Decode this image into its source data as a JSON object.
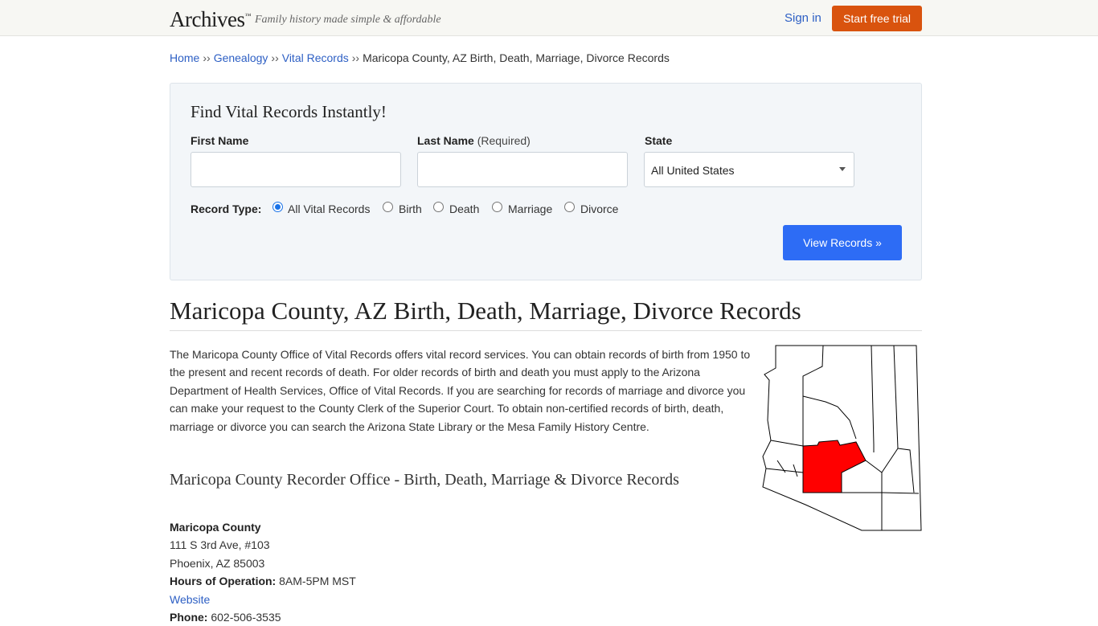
{
  "header": {
    "logo": "Archives",
    "logo_mark": "™",
    "tagline": "Family history made simple & affordable",
    "signin": "Sign in",
    "trial": "Start free trial"
  },
  "breadcrumb": {
    "items": [
      "Home",
      "Genealogy",
      "Vital Records"
    ],
    "separator": "››",
    "current": "Maricopa County, AZ Birth, Death, Marriage, Divorce Records"
  },
  "search": {
    "title": "Find Vital Records Instantly!",
    "first_name_label": "First Name",
    "last_name_label": "Last Name",
    "last_name_req": "(Required)",
    "state_label": "State",
    "state_value": "All United States",
    "record_type_label": "Record Type:",
    "record_types": [
      "All Vital Records",
      "Birth",
      "Death",
      "Marriage",
      "Divorce"
    ],
    "selected_record_type": "All Vital Records",
    "submit": "View Records »"
  },
  "main": {
    "title": "Maricopa County, AZ Birth, Death, Marriage, Divorce Records",
    "intro": "The Maricopa County Office of Vital Records offers vital record services. You can obtain records of birth from 1950 to the present and recent records of death. For older records of birth and death you must apply to the Arizona Department of Health Services, Office of Vital Records. If you are searching for records of marriage and divorce you can make your request to the County Clerk of the Superior Court. To obtain non-certified records of birth, death, marriage or divorce you can search the Arizona State Library or the Mesa Family History Centre.",
    "section_title": "Maricopa County Recorder Office - Birth, Death, Marriage & Divorce Records"
  },
  "office": {
    "name": "Maricopa County",
    "street": "111 S 3rd Ave, #103",
    "city": "Phoenix, AZ 85003",
    "hours_label": "Hours of Operation:",
    "hours": "8AM-5PM MST",
    "website": "Website",
    "phone_label": "Phone:",
    "phone": "602-506-3535"
  },
  "map": {
    "highlight_color": "#ff0000",
    "outline_color": "#000000"
  }
}
